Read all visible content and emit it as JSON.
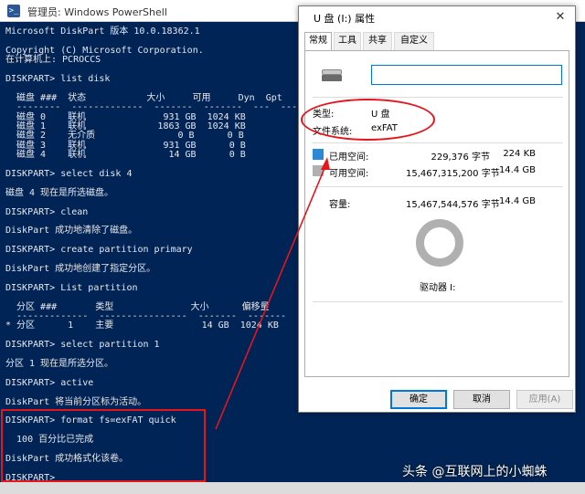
{
  "powershell": {
    "title": "管理员: Windows PowerShell",
    "lines": [
      "Microsoft DiskPart 版本 10.0.18362.1",
      "",
      "Copyright (C) Microsoft Corporation.",
      "在计算机上: PCROCCS",
      "",
      "DISKPART> list disk",
      "",
      "  磁盘 ###  状态           大小     可用     Dyn  Gpt",
      "  --------  -------------  -------  -------  ---  ---",
      "  磁盘 0    联机              931 GB  1024 KB",
      "  磁盘 1    联机             1863 GB  1024 KB",
      "  磁盘 2    无介质               0 B      0 B",
      "  磁盘 3    联机              931 GB      0 B",
      "  磁盘 4    联机               14 GB      0 B",
      "",
      "DISKPART> select disk 4",
      "",
      "磁盘 4 现在是所选磁盘。",
      "",
      "DISKPART> clean",
      "",
      "DiskPart 成功地清除了磁盘。",
      "",
      "DISKPART> create partition primary",
      "",
      "DiskPart 成功地创建了指定分区。",
      "",
      "DISKPART> List partition",
      "",
      "  分区 ###       类型              大小      偏移量",
      "  -------------  ----------------  -------  -------",
      "* 分区      1    主要                14 GB  1024 KB",
      "",
      "DISKPART> select partition 1",
      "",
      "分区 1 现在是所选分区。",
      "",
      "DISKPART> active",
      "",
      "DiskPart 将当前分区标为活动。",
      "",
      "DISKPART> format fs=exFAT quick",
      "",
      "  100 百分比已完成",
      "",
      "DiskPart 成功格式化该卷。",
      "",
      "DISKPART>"
    ]
  },
  "dialog": {
    "title": "U 盘 (I:) 属性",
    "close_glyph": "✕",
    "tabs": [
      "常规",
      "工具",
      "共享",
      "自定义"
    ],
    "name_value": "",
    "type_label": "类型:",
    "type_value": "U 盘",
    "fs_label": "文件系统:",
    "fs_value": "exFAT",
    "used_label": "已用空间:",
    "used_bytes": "229,376 字节",
    "used_size": "224 KB",
    "free_label": "可用空间:",
    "free_bytes": "15,467,315,200 字节",
    "free_size": "14.4 GB",
    "cap_label": "容量:",
    "cap_bytes": "15,467,544,576 字节",
    "cap_size": "14.4 GB",
    "drive_label": "驱动器 I:",
    "used_fraction": 1.48e-05,
    "buttons": {
      "ok": "确定",
      "cancel": "取消",
      "apply": "应用(A)"
    },
    "colors": {
      "used": "#2b8ad8",
      "free": "#b0b0b0"
    }
  },
  "watermark": "头条 @互联网上的小蜘蛛"
}
